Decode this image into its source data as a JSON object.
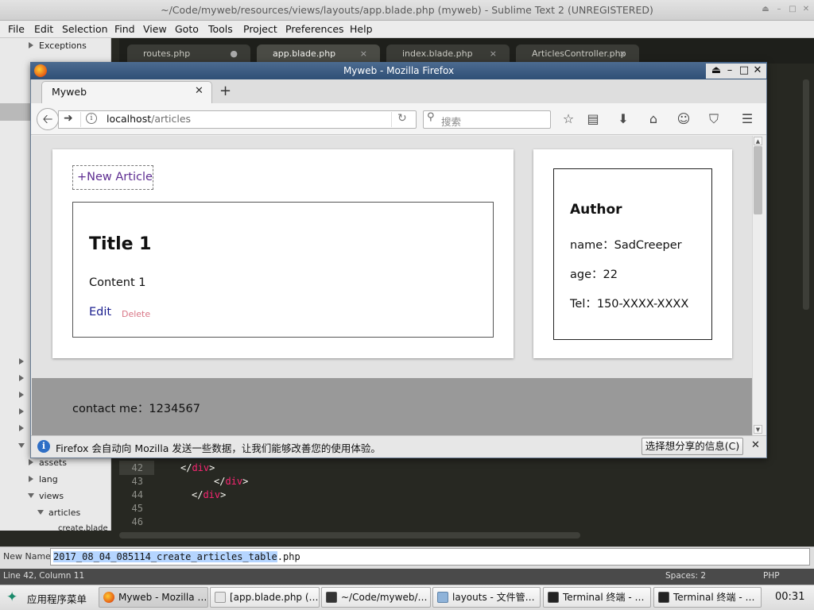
{
  "sublime": {
    "title": "~/Code/myweb/resources/views/layouts/app.blade.php (myweb) - Sublime Text 2 (UNREGISTERED)",
    "menu": [
      "File",
      "Edit",
      "Selection",
      "Find",
      "View",
      "Goto",
      "Tools",
      "Project",
      "Preferences",
      "Help"
    ],
    "sidebar": {
      "exceptions": "Exceptions",
      "assets": "assets",
      "lang": "lang",
      "views": "views",
      "articles": "articles",
      "create_blade": "create.blade"
    },
    "tabs": [
      {
        "label": "routes.php",
        "marker": "●"
      },
      {
        "label": "app.blade.php",
        "marker": "×"
      },
      {
        "label": "index.blade.php",
        "marker": "×"
      },
      {
        "label": "ArticlesController.php",
        "marker": "×"
      }
    ],
    "gutter": [
      "42",
      "43",
      "44",
      "45",
      "46"
    ],
    "code": [
      {
        "open": "</",
        "tag": "div",
        "close": ">"
      },
      {
        "open": "</",
        "tag": "div",
        "close": ">"
      },
      {
        "open": "</",
        "tag": "div",
        "close": ">"
      }
    ],
    "input_label": "New Name:",
    "input_selected": "2017_08_04_085114_create_articles_table",
    "input_rest": ".php",
    "status_left": "Line 42, Column 11",
    "status_spaces": "Spaces: 2",
    "status_syntax": "PHP"
  },
  "firefox": {
    "title": "Myweb - Mozilla Firefox",
    "tab_label": "Myweb",
    "url_host": "localhost",
    "url_path": "/articles",
    "search_placeholder": "搜索",
    "notification": "Firefox 会自动向 Mozilla 发送一些数据，让我们能够改善您的使用体验。",
    "notification_button": "选择想分享的信息(C)"
  },
  "page": {
    "new_article": "+New Article",
    "article": {
      "title": "Title 1",
      "content": "Content 1",
      "edit": "Edit",
      "delete": "Delete"
    },
    "author": {
      "heading": "Author",
      "name": "name：SadCreeper",
      "age": "age：22",
      "tel": "Tel：150-XXXX-XXXX"
    },
    "footer": "contact me：1234567"
  },
  "taskbar": {
    "start": "应用程序菜单",
    "items": [
      "Myweb - Mozilla …",
      "[app.blade.php (…",
      "~/Code/myweb/…",
      "layouts - 文件管…",
      "Terminal 终端 - …",
      "Terminal 终端 - …"
    ],
    "clock": "00:31"
  },
  "colors": {
    "firefox_titlebar": "#3d5d84",
    "link_purple": "#5d2d91",
    "edit_link": "#1b1f8f",
    "delete_link": "#d97686",
    "footer_bg": "#999999",
    "code_tag": "#f92672"
  }
}
